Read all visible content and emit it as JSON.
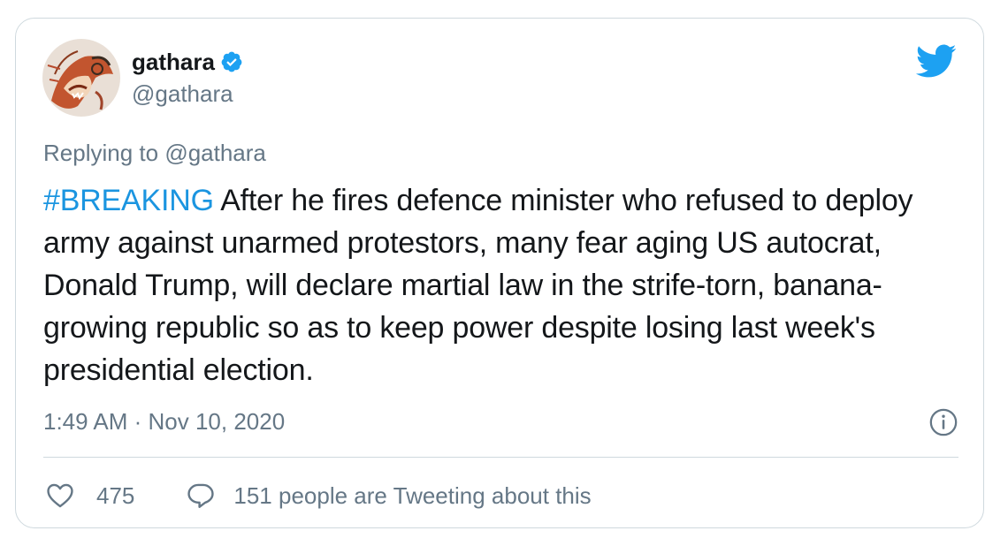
{
  "author": {
    "display_name": "gathara",
    "handle": "@gathara",
    "verified_icon": "verified-badge-icon",
    "avatar": "avatar"
  },
  "brand": {
    "icon": "twitter-bird-icon",
    "color": "#1da1f2"
  },
  "reply": {
    "prefix": "Replying to",
    "handle": "@gathara"
  },
  "tweet": {
    "hashtag": "#BREAKING",
    "text": "After he fires defence minister who refused to deploy army against unarmed protestors, many fear aging US autocrat, Donald Trump, will declare martial law in the strife-torn, banana-growing republic so as to keep power despite losing last week's presidential election."
  },
  "timestamp": "1:49 AM · Nov 10, 2020",
  "info_icon": "info-icon",
  "actions": {
    "likes": "475",
    "conversation": "151 people are Tweeting about this"
  },
  "colors": {
    "link": "#1b95e0",
    "muted": "#657786",
    "border": "#cfd9de",
    "text": "#14171a"
  }
}
